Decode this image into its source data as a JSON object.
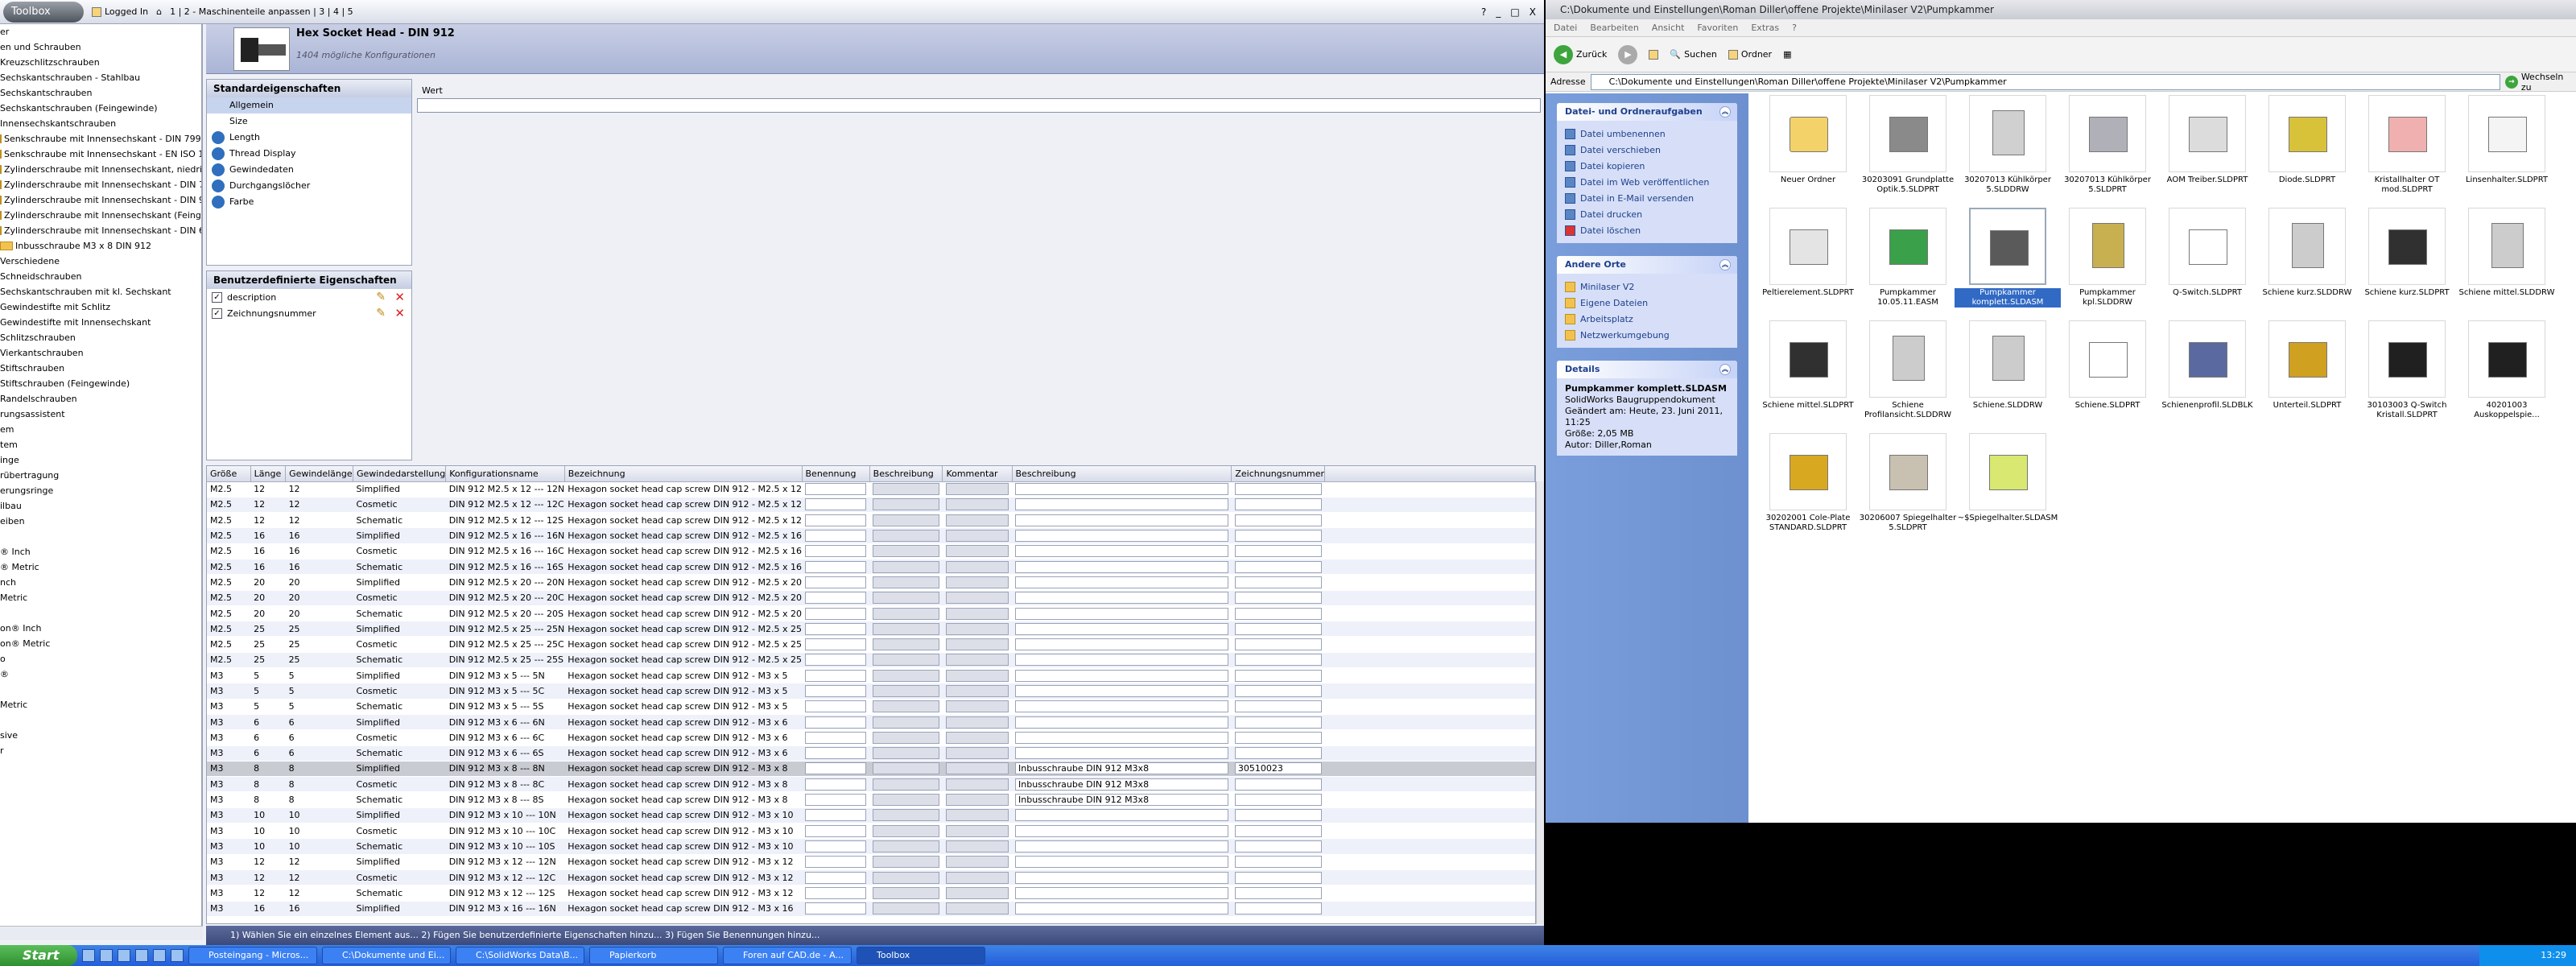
{
  "toolbox": {
    "logo": "Toolbox",
    "logged_in": "Logged In",
    "breadcrumb_prefix": "1 | 2 - Maschinenteile anpassen | 3 | 4 | 5",
    "help": "?",
    "min": "_",
    "max": "□",
    "close": "X"
  },
  "tree": [
    "er",
    "en und Schrauben",
    "Kreuzschlitzschrauben",
    "Sechskantschrauben - Stahlbau",
    "Sechskantschrauben",
    "Sechskantschrauben (Feingewinde)",
    "Innensechskantschrauben",
    "Senkschraube mit Innensechskant - DIN 7991",
    "Senkschraube mit Innensechskant - EN ISO 1",
    "Zylinderschraube mit Innensechskant, niedrige",
    "Zylinderschraube mit Innensechskant - DIN 79",
    "Zylinderschraube mit Innensechskant - DIN 91",
    "Zylinderschraube mit Innensechskant (Feingew",
    "Zylinderschraube mit Innensechskant - DIN 6",
    "Inbusschraube M3 x 8 DIN 912",
    "Verschiedene",
    "Schneidschrauben",
    "Sechskantschrauben mit kl. Sechskant",
    "Gewindestifte mit Schlitz",
    "Gewindestifte mit Innensechskant",
    "Schlitzschrauben",
    "Vierkantschrauben",
    "Stiftschrauben",
    "Stiftschrauben (Feingewinde)",
    "Randelschrauben",
    "rungsassistent",
    "em",
    "tem",
    "inge",
    "rübertragung",
    "erungsringe",
    "ilbau",
    "eiben",
    "",
    "® Inch",
    "® Metric",
    "nch",
    "Metric",
    "",
    "on® Inch",
    "on® Metric",
    "o",
    "®",
    "",
    "Metric",
    "",
    "sive",
    "r"
  ],
  "header": {
    "title": "Hex Socket Head - DIN 912",
    "subtitle": "1404 mögliche Konfigurationen"
  },
  "std": {
    "title": "Standardeigenschaften",
    "items": [
      "Allgemein",
      "Size",
      "Length",
      "Thread Display",
      "Gewindedaten",
      "Durchgangslöcher",
      "Farbe"
    ]
  },
  "user": {
    "title": "Benutzerdefinierte Eigenschaften",
    "items": [
      "description",
      "Zeichnungsnummer"
    ]
  },
  "wert": {
    "label": "Wert",
    "value": ""
  },
  "grid": {
    "headers": [
      "Größe",
      "Länge",
      "Gewindelänge",
      "Gewindedarstellung",
      "Konfigurationsname",
      "Bezeichnung",
      "Benennung",
      "Beschreibung",
      "Kommentar",
      "Beschreibung",
      "Zeichnungsnummer"
    ],
    "rows": [
      [
        "M2.5",
        "12",
        "12",
        "Simplified",
        "DIN 912 M2.5 x 12 --- 12N",
        "Hexagon socket head cap screw DIN 912 - M2.5 x 12",
        "",
        "",
        "",
        "",
        ""
      ],
      [
        "M2.5",
        "12",
        "12",
        "Cosmetic",
        "DIN 912 M2.5 x 12 --- 12C",
        "Hexagon socket head cap screw DIN 912 - M2.5 x 12",
        "",
        "",
        "",
        "",
        ""
      ],
      [
        "M2.5",
        "12",
        "12",
        "Schematic",
        "DIN 912 M2.5 x 12 --- 12S",
        "Hexagon socket head cap screw DIN 912 - M2.5 x 12",
        "",
        "",
        "",
        "",
        ""
      ],
      [
        "M2.5",
        "16",
        "16",
        "Simplified",
        "DIN 912 M2.5 x 16 --- 16N",
        "Hexagon socket head cap screw DIN 912 - M2.5 x 16",
        "",
        "",
        "",
        "",
        ""
      ],
      [
        "M2.5",
        "16",
        "16",
        "Cosmetic",
        "DIN 912 M2.5 x 16 --- 16C",
        "Hexagon socket head cap screw DIN 912 - M2.5 x 16",
        "",
        "",
        "",
        "",
        ""
      ],
      [
        "M2.5",
        "16",
        "16",
        "Schematic",
        "DIN 912 M2.5 x 16 --- 16S",
        "Hexagon socket head cap screw DIN 912 - M2.5 x 16",
        "",
        "",
        "",
        "",
        ""
      ],
      [
        "M2.5",
        "20",
        "20",
        "Simplified",
        "DIN 912 M2.5 x 20 --- 20N",
        "Hexagon socket head cap screw DIN 912 - M2.5 x 20",
        "",
        "",
        "",
        "",
        ""
      ],
      [
        "M2.5",
        "20",
        "20",
        "Cosmetic",
        "DIN 912 M2.5 x 20 --- 20C",
        "Hexagon socket head cap screw DIN 912 - M2.5 x 20",
        "",
        "",
        "",
        "",
        ""
      ],
      [
        "M2.5",
        "20",
        "20",
        "Schematic",
        "DIN 912 M2.5 x 20 --- 20S",
        "Hexagon socket head cap screw DIN 912 - M2.5 x 20",
        "",
        "",
        "",
        "",
        ""
      ],
      [
        "M2.5",
        "25",
        "25",
        "Simplified",
        "DIN 912 M2.5 x 25 --- 25N",
        "Hexagon socket head cap screw DIN 912 - M2.5 x 25",
        "",
        "",
        "",
        "",
        ""
      ],
      [
        "M2.5",
        "25",
        "25",
        "Cosmetic",
        "DIN 912 M2.5 x 25 --- 25C",
        "Hexagon socket head cap screw DIN 912 - M2.5 x 25",
        "",
        "",
        "",
        "",
        ""
      ],
      [
        "M2.5",
        "25",
        "25",
        "Schematic",
        "DIN 912 M2.5 x 25 --- 25S",
        "Hexagon socket head cap screw DIN 912 - M2.5 x 25",
        "",
        "",
        "",
        "",
        ""
      ],
      [
        "M3",
        "5",
        "5",
        "Simplified",
        "DIN 912 M3 x 5 --- 5N",
        "Hexagon socket head cap screw DIN 912 - M3 x 5",
        "",
        "",
        "",
        "",
        ""
      ],
      [
        "M3",
        "5",
        "5",
        "Cosmetic",
        "DIN 912 M3 x 5 --- 5C",
        "Hexagon socket head cap screw DIN 912 - M3 x 5",
        "",
        "",
        "",
        "",
        ""
      ],
      [
        "M3",
        "5",
        "5",
        "Schematic",
        "DIN 912 M3 x 5 --- 5S",
        "Hexagon socket head cap screw DIN 912 - M3 x 5",
        "",
        "",
        "",
        "",
        ""
      ],
      [
        "M3",
        "6",
        "6",
        "Simplified",
        "DIN 912 M3 x 6 --- 6N",
        "Hexagon socket head cap screw DIN 912 - M3 x 6",
        "",
        "",
        "",
        "",
        ""
      ],
      [
        "M3",
        "6",
        "6",
        "Cosmetic",
        "DIN 912 M3 x 6 --- 6C",
        "Hexagon socket head cap screw DIN 912 - M3 x 6",
        "",
        "",
        "",
        "",
        ""
      ],
      [
        "M3",
        "6",
        "6",
        "Schematic",
        "DIN 912 M3 x 6 --- 6S",
        "Hexagon socket head cap screw DIN 912 - M3 x 6",
        "",
        "",
        "",
        "",
        ""
      ],
      [
        "M3",
        "8",
        "8",
        "Simplified",
        "DIN 912 M3 x 8 --- 8N",
        "Hexagon socket head cap screw DIN 912 - M3 x 8",
        "",
        "",
        "",
        "Inbusschraube DIN 912 M3x8",
        "30510023"
      ],
      [
        "M3",
        "8",
        "8",
        "Cosmetic",
        "DIN 912 M3 x 8 --- 8C",
        "Hexagon socket head cap screw DIN 912 - M3 x 8",
        "",
        "",
        "",
        "Inbusschraube DIN 912 M3x8",
        ""
      ],
      [
        "M3",
        "8",
        "8",
        "Schematic",
        "DIN 912 M3 x 8 --- 8S",
        "Hexagon socket head cap screw DIN 912 - M3 x 8",
        "",
        "",
        "",
        "Inbusschraube DIN 912 M3x8",
        ""
      ],
      [
        "M3",
        "10",
        "10",
        "Simplified",
        "DIN 912 M3 x 10 --- 10N",
        "Hexagon socket head cap screw DIN 912 - M3 x 10",
        "",
        "",
        "",
        "",
        ""
      ],
      [
        "M3",
        "10",
        "10",
        "Cosmetic",
        "DIN 912 M3 x 10 --- 10C",
        "Hexagon socket head cap screw DIN 912 - M3 x 10",
        "",
        "",
        "",
        "",
        ""
      ],
      [
        "M3",
        "10",
        "10",
        "Schematic",
        "DIN 912 M3 x 10 --- 10S",
        "Hexagon socket head cap screw DIN 912 - M3 x 10",
        "",
        "",
        "",
        "",
        ""
      ],
      [
        "M3",
        "12",
        "12",
        "Simplified",
        "DIN 912 M3 x 12 --- 12N",
        "Hexagon socket head cap screw DIN 912 - M3 x 12",
        "",
        "",
        "",
        "",
        ""
      ],
      [
        "M3",
        "12",
        "12",
        "Cosmetic",
        "DIN 912 M3 x 12 --- 12C",
        "Hexagon socket head cap screw DIN 912 - M3 x 12",
        "",
        "",
        "",
        "",
        ""
      ],
      [
        "M3",
        "12",
        "12",
        "Schematic",
        "DIN 912 M3 x 12 --- 12S",
        "Hexagon socket head cap screw DIN 912 - M3 x 12",
        "",
        "",
        "",
        "",
        ""
      ],
      [
        "M3",
        "16",
        "16",
        "Simplified",
        "DIN 912 M3 x 16 --- 16N",
        "Hexagon socket head cap screw DIN 912 - M3 x 16",
        "",
        "",
        "",
        "",
        ""
      ]
    ],
    "selected_row": 18
  },
  "status": "1) Wählen Sie ein einzelnes Element aus... 2) Fügen Sie benutzerdefinierte Eigenschaften hinzu... 3) Fügen Sie Benennungen hinzu...",
  "explorer": {
    "title": "C:\\Dokumente und Einstellungen\\Roman Diller\\offene Projekte\\Minilaser V2\\Pumpkammer",
    "menu": [
      "Datei",
      "Bearbeiten",
      "Ansicht",
      "Favoriten",
      "Extras",
      "?"
    ],
    "back": "Zurück",
    "search": "Suchen",
    "folders": "Ordner",
    "address_label": "Adresse",
    "address": "C:\\Dokumente und Einstellungen\\Roman Diller\\offene Projekte\\Minilaser V2\\Pumpkammer",
    "go": "Wechseln zu",
    "tasks_title": "Datei- und Ordneraufgaben",
    "tasks": [
      "Datei umbenennen",
      "Datei verschieben",
      "Datei kopieren",
      "Datei im Web veröffentlichen",
      "Datei in E-Mail versenden",
      "Datei drucken",
      "Datei löschen"
    ],
    "places_title": "Andere Orte",
    "places": [
      "Minilaser V2",
      "Eigene Dateien",
      "Arbeitsplatz",
      "Netzwerkumgebung"
    ],
    "details_title": "Details",
    "details_name": "Pumpkammer komplett.SLDASM",
    "details_lines": [
      "SolidWorks Baugruppendokument",
      "Geändert am: Heute, 23. Juni 2011, 11:25",
      "Größe: 2,05 MB",
      "Autor: Diller,Roman"
    ],
    "files": [
      {
        "name": "Neuer Ordner",
        "icon": "folder-icon",
        "color": "#f4d26a"
      },
      {
        "name": "30203091 Grundplatte Optik.5.SLDPRT",
        "icon": "part-icon",
        "color": "#8a8a8a"
      },
      {
        "name": "30207013 Kühlkörper 5.SLDDRW",
        "icon": "drawing-icon",
        "color": "#d0d0d0"
      },
      {
        "name": "30207013 Kühlkörper 5.SLDPRT",
        "icon": "part-icon",
        "color": "#b0b0b8"
      },
      {
        "name": "AOM Treiber.SLDPRT",
        "icon": "part-icon",
        "color": "#dcdcdc"
      },
      {
        "name": "Diode.SLDPRT",
        "icon": "part-icon",
        "color": "#d8c23a"
      },
      {
        "name": "Kristallhalter OT mod.SLDPRT",
        "icon": "part-icon",
        "color": "#f0b0b0"
      },
      {
        "name": "Linsenhalter.SLDPRT",
        "icon": "part-icon",
        "color": "#f4f4f4"
      },
      {
        "name": "Peltierelement.SLDPRT",
        "icon": "part-icon",
        "color": "#e4e4e4"
      },
      {
        "name": "Pumpkammer 10.05.11.EASM",
        "icon": "assembly-icon",
        "color": "#3aa04a"
      },
      {
        "name": "Pumpkammer komplett.SLDASM",
        "icon": "assembly-icon",
        "color": "#5a5a5a"
      },
      {
        "name": "Pumpkammer kpl.SLDDRW",
        "icon": "drawing-icon",
        "color": "#c8b050"
      },
      {
        "name": "Q-Switch.SLDPRT",
        "icon": "part-icon",
        "color": "#ffffff"
      },
      {
        "name": "Schiene kurz.SLDDRW",
        "icon": "drawing-icon",
        "color": "#cccccc"
      },
      {
        "name": "Schiene kurz.SLDPRT",
        "icon": "part-icon",
        "color": "#303030"
      },
      {
        "name": "Schiene mittel.SLDDRW",
        "icon": "drawing-icon",
        "color": "#cccccc"
      },
      {
        "name": "Schiene mittel.SLDPRT",
        "icon": "part-icon",
        "color": "#303030"
      },
      {
        "name": "Schiene Profilansicht.SLDDRW",
        "icon": "drawing-icon",
        "color": "#cccccc"
      },
      {
        "name": "Schiene.SLDDRW",
        "icon": "drawing-icon",
        "color": "#cccccc"
      },
      {
        "name": "Schiene.SLDPRT",
        "icon": "part-icon",
        "color": "#ffffff"
      },
      {
        "name": "Schienenprofil.SLDBLK",
        "icon": "block-icon",
        "color": "#5a6aa0"
      },
      {
        "name": "Unterteil.SLDPRT",
        "icon": "part-icon",
        "color": "#d0a020"
      },
      {
        "name": "30103003 Q-Switch Kristall.SLDPRT",
        "icon": "part-icon",
        "color": "#202020"
      },
      {
        "name": "40201003 Auskoppelspie...",
        "icon": "part-icon",
        "color": "#202020"
      },
      {
        "name": "30202001 Cole-Plate STANDARD.SLDPRT",
        "icon": "part-icon",
        "color": "#d8a820"
      },
      {
        "name": "30206007 Spiegelhalter 5.SLDPRT",
        "icon": "part-icon",
        "color": "#c8c0b0"
      },
      {
        "name": "~$Spiegelhalter.SLDASM",
        "icon": "assembly-icon",
        "color": "#d8e870"
      }
    ],
    "selected_file": 10
  },
  "taskbar": {
    "start": "Start",
    "items": [
      "Posteingang - Micros...",
      "C:\\Dokumente und Ei...",
      "C:\\SolidWorks Data\\B...",
      "Papierkorb",
      "Foren auf CAD.de - A...",
      "Toolbox"
    ],
    "active": 5,
    "clock": "13:29"
  }
}
